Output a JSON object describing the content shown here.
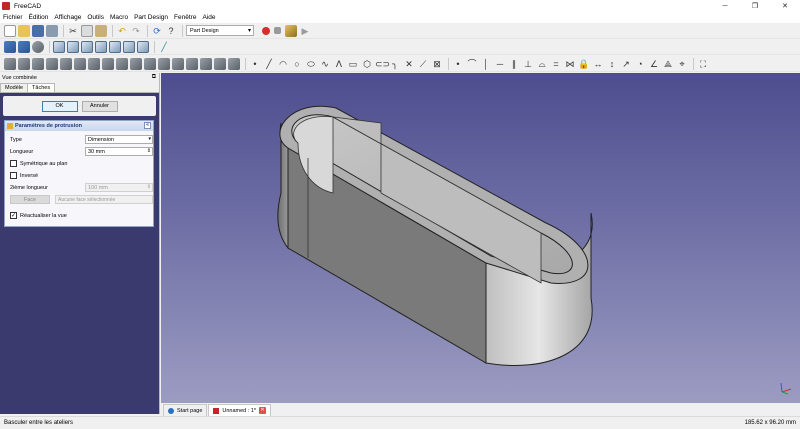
{
  "window": {
    "title": "FreeCAD"
  },
  "window_controls": {
    "minimize": "─",
    "maximize": "❐",
    "close": "✕"
  },
  "menu": [
    "Fichier",
    "Édition",
    "Affichage",
    "Outils",
    "Macro",
    "Part Design",
    "Fenêtre",
    "Aide"
  ],
  "workbench": {
    "selected": "Part Design"
  },
  "combo_view": {
    "title": "Vue combinée",
    "tabs": [
      "Modèle",
      "Tâches"
    ],
    "active_tab": "Tâches",
    "ok_label": "OK",
    "cancel_label": "Annuler"
  },
  "params": {
    "title": "Paramètres de protrusion",
    "type_label": "Type",
    "type_value": "Dimension",
    "length_label": "Longueur",
    "length_value": "30 mm",
    "symmetric_label": "Symétrique au plan",
    "symmetric_checked": false,
    "reversed_label": "Inversé",
    "reversed_checked": false,
    "second_length_label": "2ième longueur",
    "second_length_value": "100 mm",
    "face_button_label": "Face",
    "face_field_value": "Aucune face sélectionnée",
    "refresh_label": "Réactualiser la vue",
    "refresh_checked": true
  },
  "doc_tabs": [
    {
      "label": "Start page",
      "active": false
    },
    {
      "label": "Unnamed : 1*",
      "active": true
    }
  ],
  "status": {
    "left": "Basculer entre les ateliers",
    "right": "185.62 x 96.20 mm"
  },
  "colors": {
    "viewport_top": "#4d4d8f",
    "viewport_bottom": "#9c9cc2",
    "task_panel_bg": "#3b3a6e",
    "record_red": "#d32f2f"
  }
}
